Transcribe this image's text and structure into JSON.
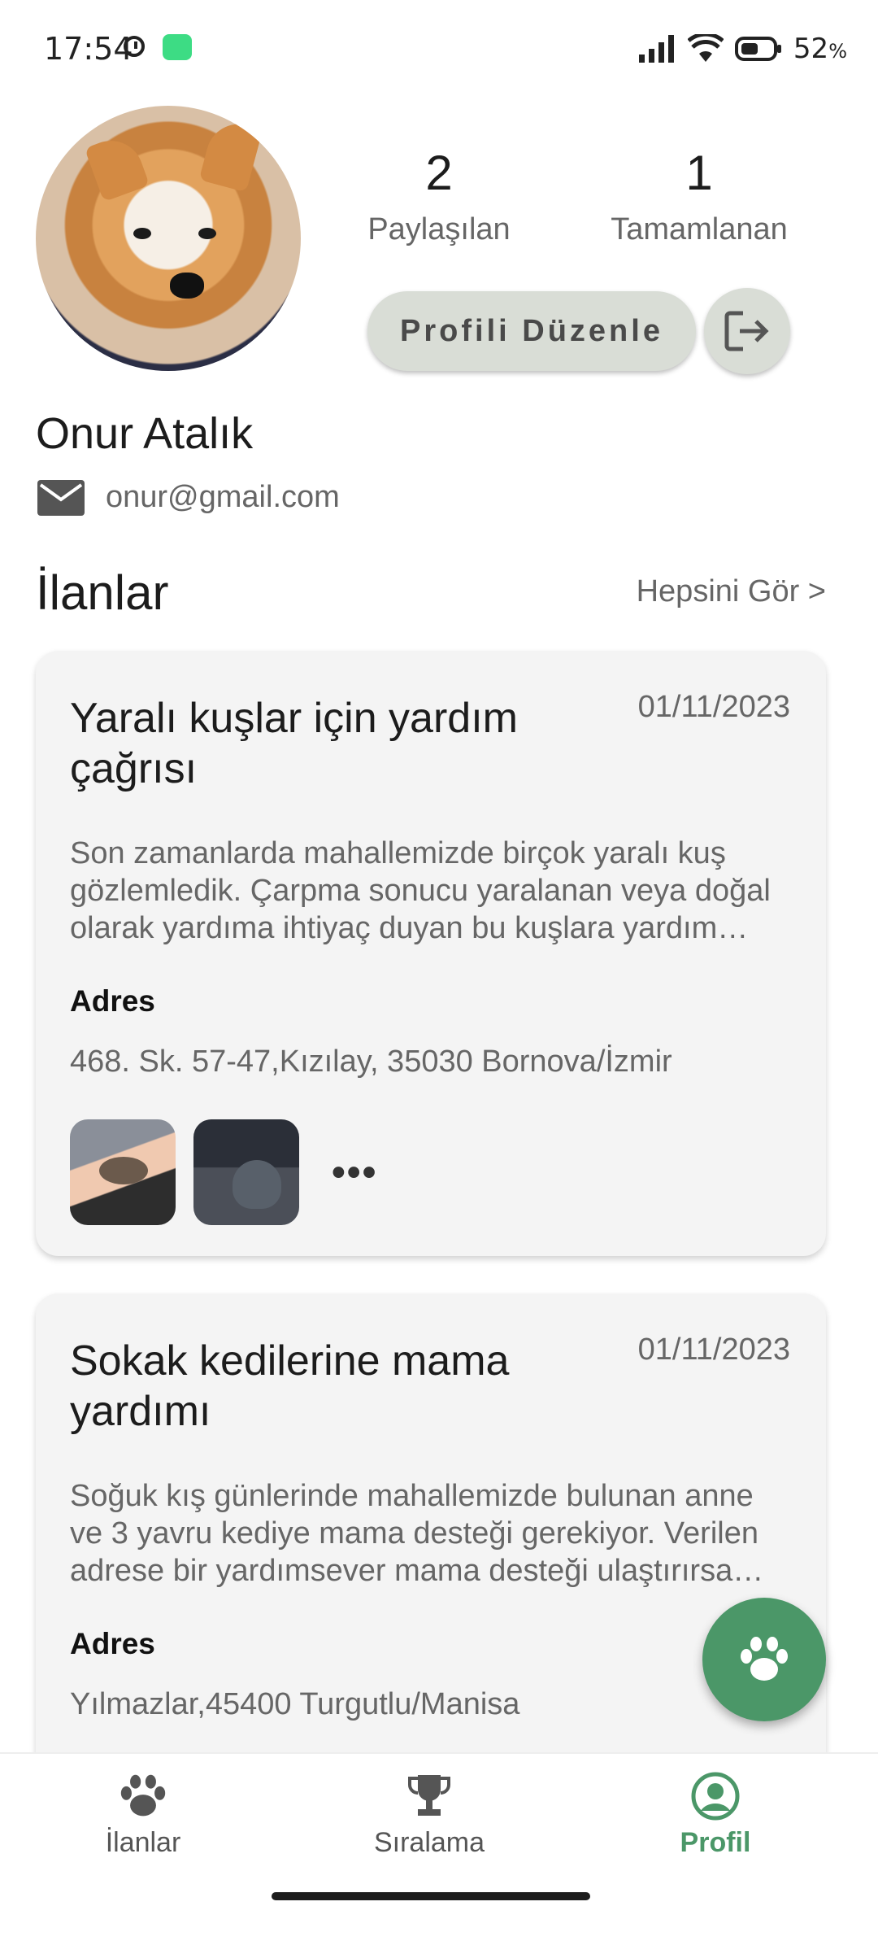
{
  "status_bar": {
    "time": "17:54",
    "battery": "52",
    "battery_unit": "%"
  },
  "profile": {
    "stats": [
      {
        "value": "2",
        "label": "Paylaşılan"
      },
      {
        "value": "1",
        "label": "Tamamlanan"
      }
    ],
    "edit_label": "Profili Düzenle",
    "name": "Onur Atalık",
    "email": "onur@gmail.com"
  },
  "section": {
    "title": "İlanlar",
    "see_all": "Hepsini Gör >"
  },
  "posts": [
    {
      "title": "Yaralı kuşlar için yardım çağrısı",
      "date": "01/11/2023",
      "description": "Son zamanlarda mahallemizde birçok yaralı kuş gözlemledik. Çarpma sonucu yaralanan veya doğal olarak yardıma ihtiyaç duyan bu kuşlara yardım etmek için",
      "address_label": "Adres",
      "address": "468. Sk. 57-47,Kızılay, 35030 Bornova/İzmir",
      "more": "•••"
    },
    {
      "title": "Sokak kedilerine mama yardımı",
      "date": "01/11/2023",
      "description": "Soğuk kış günlerinde mahallemizde bulunan anne ve 3 yavru kediye mama desteği gerekiyor. Verilen adrese bir yardımsever mama desteği ulaştırırsa sevinirim.",
      "address_label": "Adres",
      "address": "Yılmazlar,45400 Turgutlu/Manisa"
    }
  ],
  "nav": [
    {
      "label": "İlanlar",
      "icon": "paw-icon"
    },
    {
      "label": "Sıralama",
      "icon": "trophy-icon"
    },
    {
      "label": "Profil",
      "icon": "account-circle-icon",
      "active": true
    }
  ],
  "colors": {
    "accent": "#4b9768",
    "button_bg": "#d9ddd6",
    "card_bg": "#f4f4f4"
  }
}
